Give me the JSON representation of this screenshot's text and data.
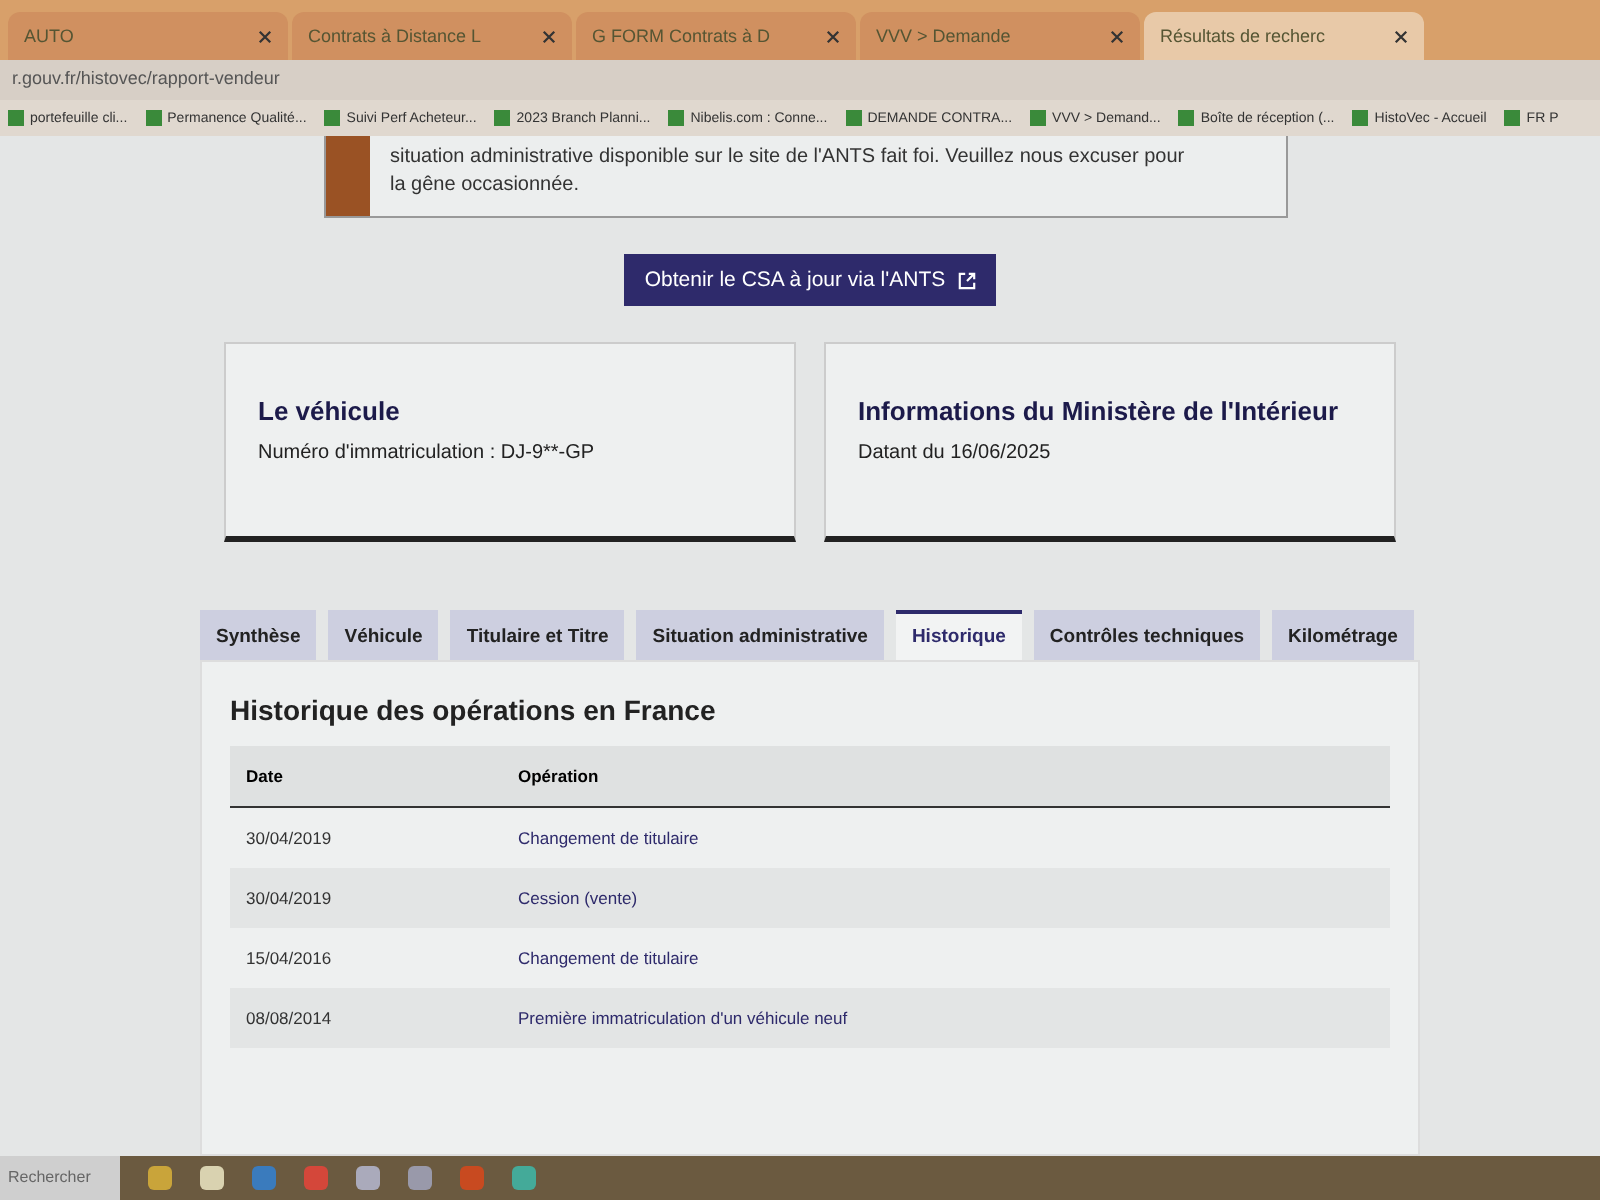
{
  "browser_tabs": [
    {
      "title": "AUTO",
      "selected": false
    },
    {
      "title": "Contrats à Distance L",
      "selected": false
    },
    {
      "title": "G FORM Contrats à D",
      "selected": false
    },
    {
      "title": "VVV > Demande",
      "selected": false
    },
    {
      "title": "Résultats de recherc",
      "selected": true
    }
  ],
  "address_bar": {
    "url": "r.gouv.fr/histovec/rapport-vendeur"
  },
  "bookmarks": [
    "portefeuille cli...",
    "Permanence Qualité...",
    "Suivi Perf Acheteur...",
    "2023 Branch Planni...",
    "Nibelis.com : Conne...",
    "DEMANDE CONTRA...",
    "VVV > Demand...",
    "Boîte de réception (...",
    "HistoVec - Accueil",
    "FR P"
  ],
  "notice": {
    "lines": [
      "situation administrative disponible sur le site de l'ANTS fait foi. Veuillez nous excuser pour",
      "la gêne occasionnée."
    ]
  },
  "csa_button": {
    "label": "Obtenir le CSA à jour via l'ANTS"
  },
  "cards": [
    {
      "title": "Le véhicule",
      "text": "Numéro d'immatriculation : DJ-9**-GP"
    },
    {
      "title": "Informations du Ministère de l'Intérieur",
      "text": "Datant du 16/06/2025"
    }
  ],
  "tabs": [
    {
      "label": "Synthèse",
      "selected": false
    },
    {
      "label": "Véhicule",
      "selected": false
    },
    {
      "label": "Titulaire et Titre",
      "selected": false
    },
    {
      "label": "Situation administrative",
      "selected": false
    },
    {
      "label": "Historique",
      "selected": true
    },
    {
      "label": "Contrôles techniques",
      "selected": false
    },
    {
      "label": "Kilométrage",
      "selected": false
    }
  ],
  "history": {
    "title": "Historique des opérations en France",
    "columns": [
      "Date",
      "Opération"
    ],
    "rows": [
      {
        "date": "30/04/2019",
        "operation": "Changement de titulaire"
      },
      {
        "date": "30/04/2019",
        "operation": "Cession (vente)"
      },
      {
        "date": "15/04/2016",
        "operation": "Changement de titulaire"
      },
      {
        "date": "08/08/2014",
        "operation": "Première immatriculation d'un véhicule neuf"
      }
    ]
  },
  "taskbar": {
    "search_placeholder": "Rechercher"
  }
}
